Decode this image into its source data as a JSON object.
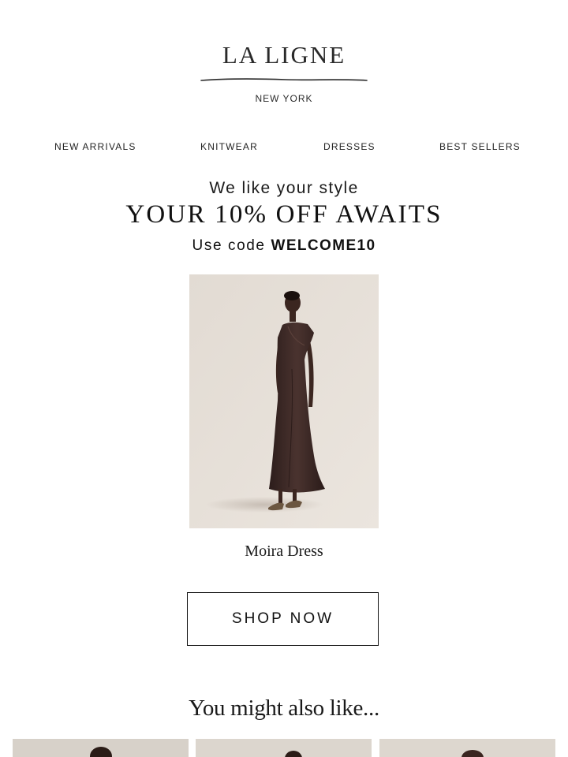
{
  "header": {
    "brand": "LA LIGNE",
    "location": "NEW YORK"
  },
  "nav": {
    "items": [
      "NEW ARRIVALS",
      "KNITWEAR",
      "DRESSES",
      "BEST SELLERS"
    ]
  },
  "promo": {
    "kicker": "We like your style",
    "title": "YOUR 10% OFF AWAITS",
    "code_prefix": "Use code",
    "code": "WELCOME10"
  },
  "featured": {
    "product_name": "Moira Dress",
    "cta": "SHOP NOW"
  },
  "recommendations": {
    "heading": "You might also like..."
  },
  "colors": {
    "background": "#ffffff",
    "text": "#1a1a1a",
    "photo_backdrop": "#e7e0d8",
    "dress": "#3a2724"
  }
}
